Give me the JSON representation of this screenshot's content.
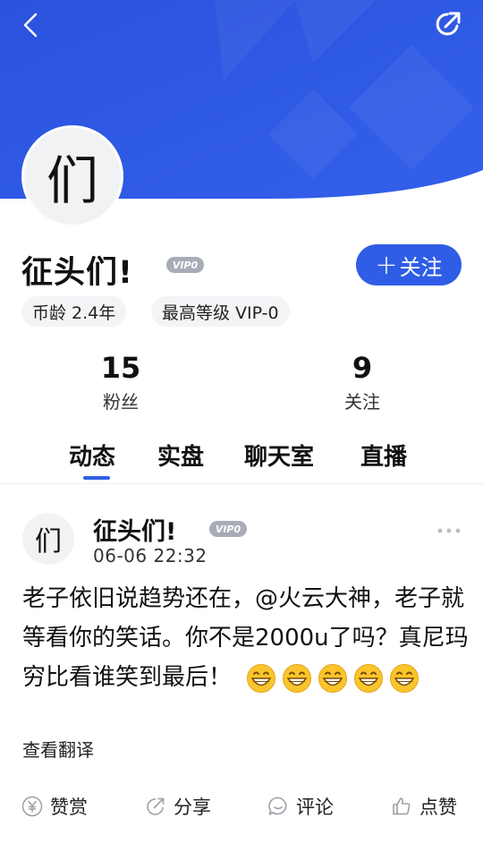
{
  "colors": {
    "accent": "#2f5de6",
    "hero_blue": "#2e55e0",
    "vip_gray": "#a7acb6"
  },
  "header": {
    "back_icon": "chevron-left-icon",
    "share_icon": "share-arrow-icon"
  },
  "profile": {
    "avatar_char": "们",
    "name": "征头们!",
    "vip_label": "VIP0",
    "follow_label": "关注",
    "coin_age": "币龄 2.4年",
    "max_level": "最高等级 VIP-0"
  },
  "stats": [
    {
      "value": "15",
      "label": "粉丝"
    },
    {
      "value": "9",
      "label": "关注"
    }
  ],
  "tabs": [
    {
      "label": "动态",
      "active": true
    },
    {
      "label": "实盘"
    },
    {
      "label": "聊天室"
    },
    {
      "label": "直播"
    }
  ],
  "post": {
    "avatar_char": "们",
    "author": "征头们!",
    "vip_label": "VIP0",
    "time": "06-06 22:32",
    "text": "老子依旧说趋势还在，@火云大神，老子就等看你的笑话。你不是2000u了吗？真尼玛穷比看谁笑到最后！",
    "emojis": [
      "grin-emoji",
      "grin-emoji",
      "grin-emoji",
      "grin-emoji",
      "grin-emoji"
    ],
    "translate_label": "查看翻译"
  },
  "actions": [
    {
      "label": "赞赏",
      "icon": "yen-coin-icon"
    },
    {
      "label": "分享",
      "icon": "share-icon"
    },
    {
      "label": "评论",
      "icon": "comment-icon"
    },
    {
      "label": "点赞",
      "icon": "thumbs-up-icon"
    }
  ]
}
